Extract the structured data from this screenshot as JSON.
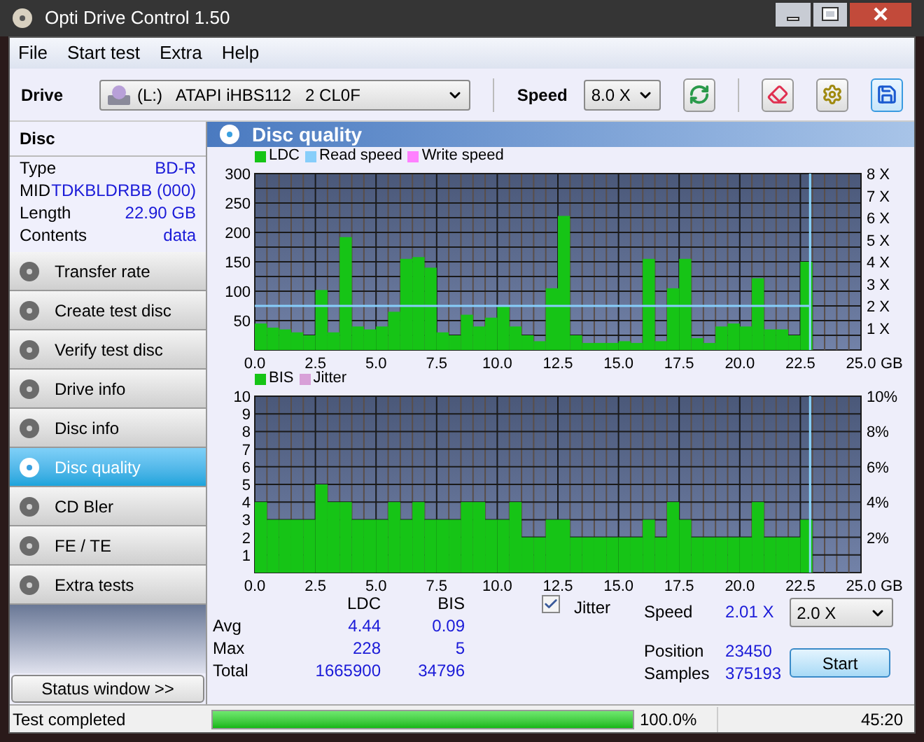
{
  "window": {
    "title": "Opti Drive Control 1.50"
  },
  "menu": [
    "File",
    "Start test",
    "Extra",
    "Help"
  ],
  "toolbar": {
    "drive_label": "Drive",
    "drive": "(L:)   ATAPI iHBS112   2 CL0F",
    "speed_label": "Speed",
    "speed": "8.0 X"
  },
  "disc": {
    "title": "Disc",
    "rows": [
      {
        "label": "Type",
        "value": "BD-R"
      },
      {
        "label": "MID",
        "value": "TDKBLDRBB (000)"
      },
      {
        "label": "Length",
        "value": "22.90 GB"
      },
      {
        "label": "Contents",
        "value": "data"
      }
    ]
  },
  "nav": [
    {
      "label": "Transfer rate",
      "selected": false
    },
    {
      "label": "Create test disc",
      "selected": false
    },
    {
      "label": "Verify test disc",
      "selected": false
    },
    {
      "label": "Drive info",
      "selected": false
    },
    {
      "label": "Disc info",
      "selected": false
    },
    {
      "label": "Disc quality",
      "selected": true
    },
    {
      "label": "CD Bler",
      "selected": false
    },
    {
      "label": "FE / TE",
      "selected": false
    },
    {
      "label": "Extra tests",
      "selected": false
    }
  ],
  "status_button": "Status window >>",
  "panel_title": "Disc quality",
  "ldc_chart": {
    "chart_data": {
      "type": "bar",
      "xlabel": "GB",
      "x": [
        0,
        0.5,
        1,
        1.5,
        2,
        2.5,
        3,
        3.5,
        4,
        4.5,
        5,
        5.5,
        6,
        6.5,
        7,
        7.5,
        8,
        8.5,
        9,
        9.5,
        10,
        10.5,
        11,
        11.5,
        12,
        12.5,
        13,
        13.5,
        14,
        14.5,
        15,
        15.5,
        16,
        16.5,
        17,
        17.5,
        18,
        18.5,
        19,
        19.5,
        20,
        20.5,
        21,
        21.5,
        22,
        22.5
      ],
      "series": [
        {
          "name": "LDC",
          "color": "#16c416",
          "values": [
            45,
            38,
            35,
            30,
            25,
            102,
            30,
            192,
            40,
            35,
            40,
            65,
            155,
            158,
            140,
            30,
            25,
            60,
            40,
            55,
            75,
            40,
            25,
            15,
            105,
            228,
            25,
            12,
            12,
            12,
            15,
            12,
            155,
            15,
            105,
            155,
            20,
            12,
            40,
            45,
            40,
            122,
            35,
            35,
            25,
            150
          ]
        },
        {
          "name": "Read speed",
          "color": "#87cefa",
          "values": [
            null,
            null,
            null,
            null,
            null,
            null,
            null,
            null,
            null,
            null,
            null,
            null,
            null,
            null,
            null,
            null,
            null,
            null,
            null,
            null,
            null,
            null,
            null,
            null,
            null,
            null,
            null,
            null,
            null,
            null,
            null,
            null,
            null,
            null,
            null,
            null,
            null,
            null,
            null,
            null,
            null,
            null,
            null,
            null,
            null,
            null
          ]
        },
        {
          "name": "Write speed",
          "color": "#ff80ff",
          "values": [
            null,
            null,
            null,
            null,
            null,
            null,
            null,
            null,
            null,
            null,
            null,
            null,
            null,
            null,
            null,
            null,
            null,
            null,
            null,
            null,
            null,
            null,
            null,
            null,
            null,
            null,
            null,
            null,
            null,
            null,
            null,
            null,
            null,
            null,
            null,
            null,
            null,
            null,
            null,
            null,
            null,
            null,
            null,
            null,
            null,
            null
          ]
        }
      ],
      "xlim": [
        0,
        25
      ],
      "ylim": [
        0,
        300
      ],
      "xticks": [
        {
          "value": 0,
          "label": "0.0"
        },
        {
          "value": 2.5,
          "label": "2.5"
        },
        {
          "value": 5,
          "label": "5.0"
        },
        {
          "value": 7.5,
          "label": "7.5"
        },
        {
          "value": 10,
          "label": "10.0"
        },
        {
          "value": 12.5,
          "label": "12.5"
        },
        {
          "value": 15,
          "label": "15.0"
        },
        {
          "value": 17.5,
          "label": "17.5"
        },
        {
          "value": 20,
          "label": "20.0"
        },
        {
          "value": 22.5,
          "label": "22.5"
        },
        {
          "value": 25,
          "label": "25.0"
        }
      ],
      "yticks": [
        50,
        100,
        150,
        200,
        250,
        300
      ],
      "grid": true,
      "ref_lines": [
        {
          "axis": "x",
          "value": 22.9,
          "color": "#8ad8ff"
        },
        {
          "axis": "y",
          "value": 75,
          "color": "#87cefa"
        }
      ]
    },
    "right_axis": [
      "8 X",
      "7 X",
      "6 X",
      "5 X",
      "4 X",
      "3 X",
      "2 X",
      "1 X"
    ]
  },
  "bis_chart": {
    "chart_data": {
      "type": "bar",
      "xlabel": "GB",
      "x": [
        0,
        0.5,
        1,
        1.5,
        2,
        2.5,
        3,
        3.5,
        4,
        4.5,
        5,
        5.5,
        6,
        6.5,
        7,
        7.5,
        8,
        8.5,
        9,
        9.5,
        10,
        10.5,
        11,
        11.5,
        12,
        12.5,
        13,
        13.5,
        14,
        14.5,
        15,
        15.5,
        16,
        16.5,
        17,
        17.5,
        18,
        18.5,
        19,
        19.5,
        20,
        20.5,
        21,
        21.5,
        22,
        22.5
      ],
      "series": [
        {
          "name": "BIS",
          "color": "#16c416",
          "values": [
            4,
            3,
            3,
            3,
            3,
            5,
            4,
            4,
            3,
            3,
            3,
            4,
            3,
            4,
            3,
            3,
            3,
            4,
            4,
            3,
            3,
            4,
            2,
            2,
            3,
            3,
            2,
            2,
            2,
            2,
            2,
            2,
            3,
            2,
            4,
            3,
            2,
            2,
            2,
            2,
            2,
            4,
            2,
            2,
            2,
            3
          ]
        },
        {
          "name": "Jitter",
          "color": "#d8a0d8",
          "values": [
            null,
            null,
            null,
            null,
            null,
            null,
            null,
            null,
            null,
            null,
            null,
            null,
            null,
            null,
            null,
            null,
            null,
            null,
            null,
            null,
            null,
            null,
            null,
            null,
            null,
            null,
            null,
            null,
            null,
            null,
            null,
            null,
            null,
            null,
            null,
            null,
            null,
            null,
            null,
            null,
            null,
            null,
            null,
            null,
            null,
            null
          ]
        }
      ],
      "xlim": [
        0,
        25
      ],
      "ylim": [
        0,
        10
      ],
      "xticks": [
        {
          "value": 0,
          "label": "0.0"
        },
        {
          "value": 2.5,
          "label": "2.5"
        },
        {
          "value": 5,
          "label": "5.0"
        },
        {
          "value": 7.5,
          "label": "7.5"
        },
        {
          "value": 10,
          "label": "10.0"
        },
        {
          "value": 12.5,
          "label": "12.5"
        },
        {
          "value": 15,
          "label": "15.0"
        },
        {
          "value": 17.5,
          "label": "17.5"
        },
        {
          "value": 20,
          "label": "20.0"
        },
        {
          "value": 22.5,
          "label": "22.5"
        },
        {
          "value": 25,
          "label": "25.0"
        }
      ],
      "yticks": [
        1,
        2,
        3,
        4,
        5,
        6,
        7,
        8,
        9,
        10
      ],
      "grid": true,
      "ref_lines": [
        {
          "axis": "x",
          "value": 22.9,
          "color": "#8ad8ff"
        }
      ]
    },
    "right_axis": [
      "10%",
      "8%",
      "6%",
      "4%",
      "2%"
    ]
  },
  "stats": {
    "columns": [
      "LDC",
      "BIS"
    ],
    "rows": [
      {
        "label": "Avg",
        "values": [
          "4.44",
          "0.09"
        ]
      },
      {
        "label": "Max",
        "values": [
          "228",
          "5"
        ]
      },
      {
        "label": "Total",
        "values": [
          "1665900",
          "34796"
        ]
      }
    ]
  },
  "jitter": {
    "label": "Jitter",
    "checked": true
  },
  "readings": [
    {
      "label": "Speed",
      "value": "2.01 X"
    },
    {
      "label": "Position",
      "value": "23450"
    },
    {
      "label": "Samples",
      "value": "375193"
    }
  ],
  "speed_select": "2.0 X",
  "start_button": "Start",
  "status_bar": {
    "text": "Test completed",
    "level": 1.0,
    "percent": "100.0%",
    "time": "45:20"
  }
}
